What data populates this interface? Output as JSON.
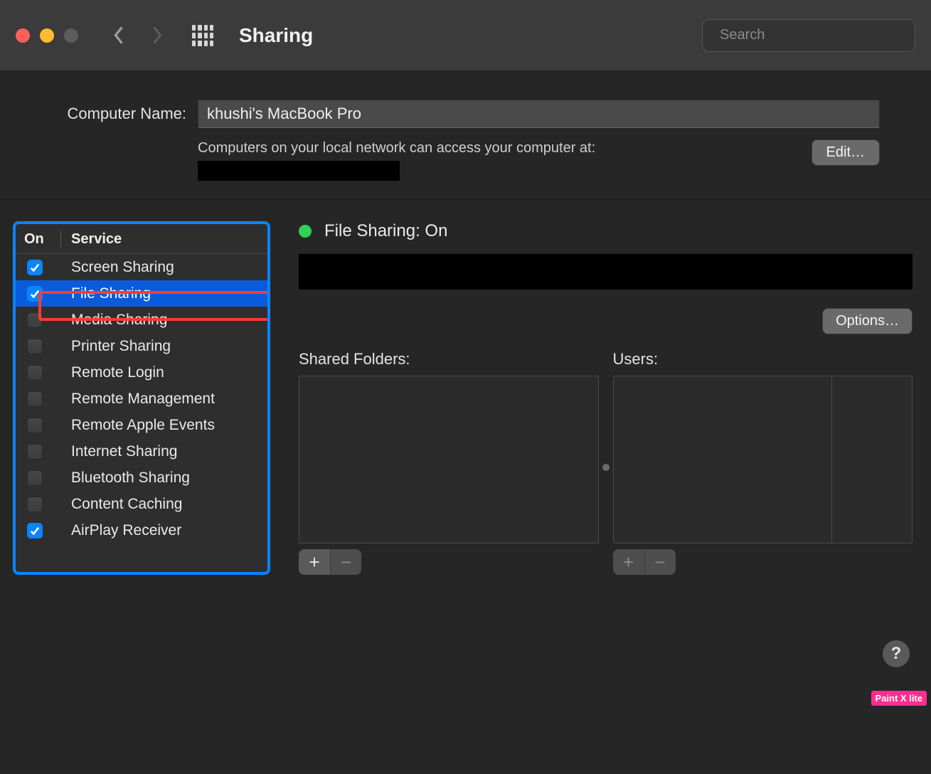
{
  "window": {
    "title": "Sharing",
    "search_placeholder": "Search"
  },
  "computer_name": {
    "label": "Computer Name:",
    "value": "khushi's MacBook Pro",
    "subtext": "Computers on your local network can access your computer at:",
    "edit_label": "Edit…"
  },
  "services": {
    "col_on": "On",
    "col_service": "Service",
    "items": [
      {
        "label": "Screen Sharing",
        "checked": true,
        "selected": false
      },
      {
        "label": "File Sharing",
        "checked": true,
        "selected": true
      },
      {
        "label": "Media Sharing",
        "checked": false,
        "selected": false
      },
      {
        "label": "Printer Sharing",
        "checked": false,
        "selected": false
      },
      {
        "label": "Remote Login",
        "checked": false,
        "selected": false
      },
      {
        "label": "Remote Management",
        "checked": false,
        "selected": false
      },
      {
        "label": "Remote Apple Events",
        "checked": false,
        "selected": false
      },
      {
        "label": "Internet Sharing",
        "checked": false,
        "selected": false
      },
      {
        "label": "Bluetooth Sharing",
        "checked": false,
        "selected": false
      },
      {
        "label": "Content Caching",
        "checked": false,
        "selected": false
      },
      {
        "label": "AirPlay Receiver",
        "checked": true,
        "selected": false
      }
    ]
  },
  "detail": {
    "status_text": "File Sharing: On",
    "status_color": "#30d158",
    "options_label": "Options…",
    "shared_folders_label": "Shared Folders:",
    "users_label": "Users:"
  },
  "help_label": "?",
  "watermark": "Paint X lite"
}
